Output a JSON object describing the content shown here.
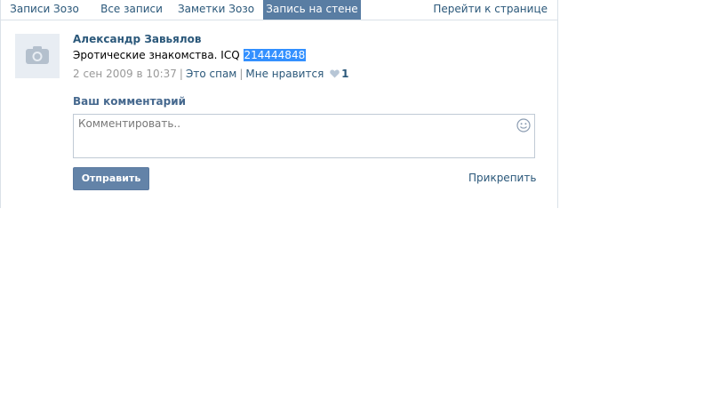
{
  "tabs": [
    {
      "label": "Записи Зозо"
    },
    {
      "label": "Все записи"
    },
    {
      "label": "Заметки Зозо"
    },
    {
      "label": "Запись на стене"
    }
  ],
  "tabs_right": {
    "label": "Перейти к странице"
  },
  "post": {
    "author": "Александр Завьялов",
    "text": "Эротические знакомства. ICQ",
    "highlighted": "214444848",
    "date": "2 сен 2009 в 10:37",
    "spam_label": "Это спам",
    "like_label": "Мне нравится",
    "like_count": "1"
  },
  "comment": {
    "label": "Ваш комментарий",
    "placeholder": "Комментировать..",
    "send_label": "Отправить",
    "attach_label": "Прикрепить"
  },
  "colors": {
    "tab_active_bg": "#597da3",
    "link": "#2b587a",
    "button_bg": "#6383a8",
    "selection": "#3390ff"
  },
  "icons": {
    "avatar": "camera-icon",
    "smile": "smile-icon",
    "like": "heart-icon"
  }
}
